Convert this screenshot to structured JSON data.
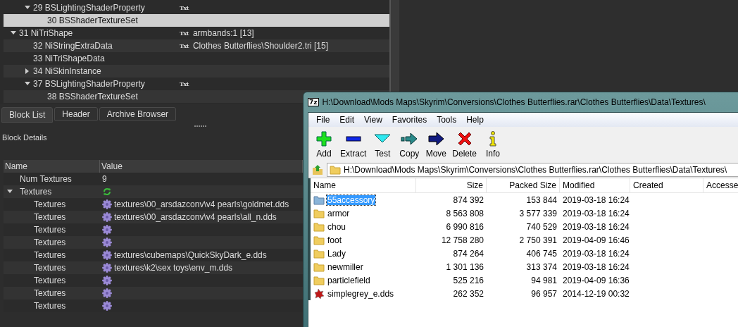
{
  "nifskope": {
    "tree": [
      {
        "children": [
          {
            "label": "29 BSLightingShaderProperty",
            "tag": "Txt",
            "expanded": true,
            "selected": false,
            "children": [
              {
                "label": "30 BSShaderTextureSet",
                "selected": true
              }
            ]
          }
        ]
      },
      {
        "label": "31 NiTriShape",
        "tag": "Txt",
        "value": "armbands:1 [13]",
        "expanded": true,
        "selected": false,
        "children": [
          {
            "label": "32 NiStringExtraData",
            "tag": "Txt",
            "value": "Clothes Butterflies\\Shoulder2.tri [15]",
            "selected": false
          },
          {
            "label": "33 NiTriShapeData",
            "selected": false
          },
          {
            "label": "34 NiSkinInstance",
            "expanded": false,
            "selected": false
          },
          {
            "label": "37 BSLightingShaderProperty",
            "tag": "Txt",
            "expanded": true,
            "selected": false,
            "children": [
              {
                "label": "38 BSShaderTextureSet",
                "selected": false
              }
            ]
          }
        ]
      }
    ],
    "tabs": [
      {
        "label": "Block List",
        "selected": true
      },
      {
        "label": "Header",
        "selected": false
      },
      {
        "label": "Archive Browser",
        "selected": false
      }
    ],
    "details_title": "Block Details",
    "details": {
      "columns": [
        "Name",
        "Value"
      ],
      "rows": [
        {
          "name": "Num Textures",
          "value": "9",
          "kind": "plain"
        },
        {
          "name": "Textures",
          "kind": "array",
          "expanded": true,
          "children": [
            {
              "name": "Textures",
              "kind": "texture",
              "value": "textures\\00_arsdazconv\\v4 pearls\\goldmet.dds"
            },
            {
              "name": "Textures",
              "kind": "texture",
              "value": "textures\\00_arsdazconv\\v4 pearls\\all_n.dds"
            },
            {
              "name": "Textures",
              "kind": "texture"
            },
            {
              "name": "Textures",
              "kind": "texture"
            },
            {
              "name": "Textures",
              "kind": "texture",
              "value": "textures\\cubemaps\\QuickSkyDark_e.dds"
            },
            {
              "name": "Textures",
              "kind": "texture",
              "value": "textures\\k2\\sex toys\\env_m.dds"
            },
            {
              "name": "Textures",
              "kind": "texture"
            },
            {
              "name": "Textures",
              "kind": "texture"
            },
            {
              "name": "Textures",
              "kind": "texture"
            }
          ]
        }
      ]
    }
  },
  "sevenzip": {
    "logo": "7z",
    "title": "H:\\Download\\Mods Maps\\Skyrim\\Conversions\\Clothes Butterflies.rar\\Clothes Butterflies\\Data\\Textures\\",
    "menu": [
      "File",
      "Edit",
      "View",
      "Favorites",
      "Tools",
      "Help"
    ],
    "toolbar": [
      {
        "label": "Add",
        "kind": "add"
      },
      {
        "label": "Extract",
        "kind": "extract"
      },
      {
        "label": "Test",
        "kind": "test"
      },
      {
        "label": "Copy",
        "kind": "copy"
      },
      {
        "label": "Move",
        "kind": "move"
      },
      {
        "label": "Delete",
        "kind": "delete"
      },
      {
        "label": "Info",
        "kind": "info"
      }
    ],
    "address": "H:\\Download\\Mods Maps\\Skyrim\\Conversions\\Clothes Butterflies.rar\\Clothes Butterflies\\Data\\Textures\\",
    "columns": [
      "Name",
      "Size",
      "Packed Size",
      "Modified",
      "Created",
      "Accesse"
    ],
    "rows": [
      {
        "name": "55accessory",
        "size": "874 392",
        "packed": "153 844",
        "modified": "2019-03-18 16:24",
        "kind": "folder",
        "selected": true
      },
      {
        "name": "armor",
        "size": "8 563 808",
        "packed": "3 577 339",
        "modified": "2019-03-18 16:24",
        "kind": "folder",
        "selected": false
      },
      {
        "name": "chou",
        "size": "6 990 816",
        "packed": "740 529",
        "modified": "2019-03-18 16:24",
        "kind": "folder",
        "selected": false
      },
      {
        "name": "foot",
        "size": "12 758 280",
        "packed": "2 750 391",
        "modified": "2019-04-09 16:46",
        "kind": "folder",
        "selected": false
      },
      {
        "name": "Lady",
        "size": "874 264",
        "packed": "406 745",
        "modified": "2019-03-18 16:24",
        "kind": "folder",
        "selected": false
      },
      {
        "name": "newmiller",
        "size": "1 301 136",
        "packed": "313 374",
        "modified": "2019-03-18 16:24",
        "kind": "folder",
        "selected": false
      },
      {
        "name": "particlefield",
        "size": "525 216",
        "packed": "94 981",
        "modified": "2019-04-09 16:36",
        "kind": "folder",
        "selected": false
      },
      {
        "name": "simplegrey_e.dds",
        "size": "262 352",
        "packed": "96 957",
        "modified": "2014-12-19 00:32",
        "kind": "file",
        "selected": false
      }
    ]
  }
}
